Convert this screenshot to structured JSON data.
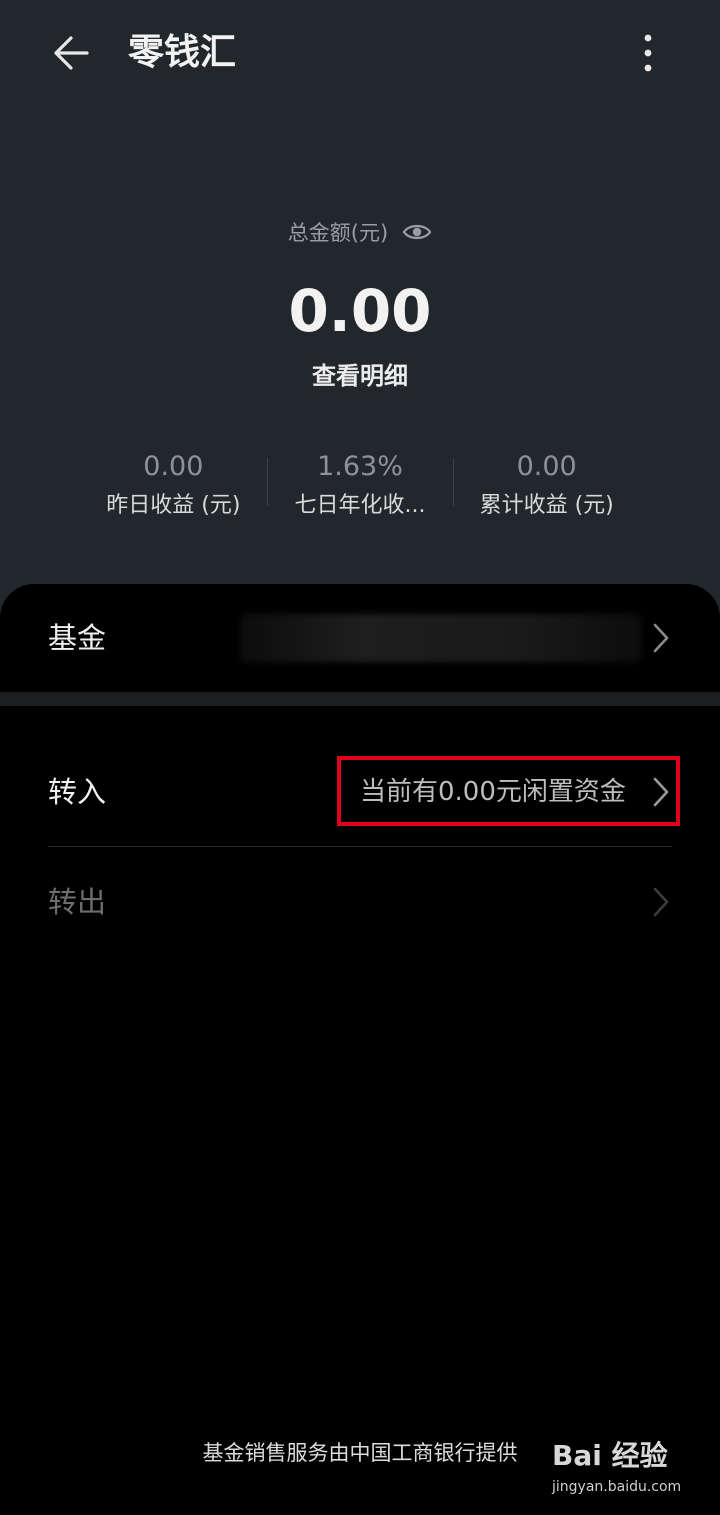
{
  "header": {
    "title": "零钱汇",
    "back_icon": "arrow-left-icon",
    "more_icon": "more-vertical-icon"
  },
  "summary": {
    "total_label": "总金额(元)",
    "eye_icon": "eye-icon",
    "total_amount": "0.00",
    "detail_link": "查看明细",
    "stats": [
      {
        "value": "0.00",
        "label": "昨日收益 (元)"
      },
      {
        "value": "1.63%",
        "label": "七日年化收..."
      },
      {
        "value": "0.00",
        "label": "累计收益 (元)"
      }
    ]
  },
  "fund_row": {
    "label": "基金"
  },
  "transfer_in": {
    "label": "转入",
    "info": "当前有0.00元闲置资金"
  },
  "transfer_out": {
    "label": "转出"
  },
  "footer": {
    "text": "基金销售服务由中国工商银行提供"
  },
  "watermark": {
    "logo": "Bai 经验",
    "url": "jingyan.baidu.com"
  },
  "colors": {
    "header_bg": "#22272b",
    "sheet_bg": "#000000",
    "highlight_border": "#e0001b"
  }
}
